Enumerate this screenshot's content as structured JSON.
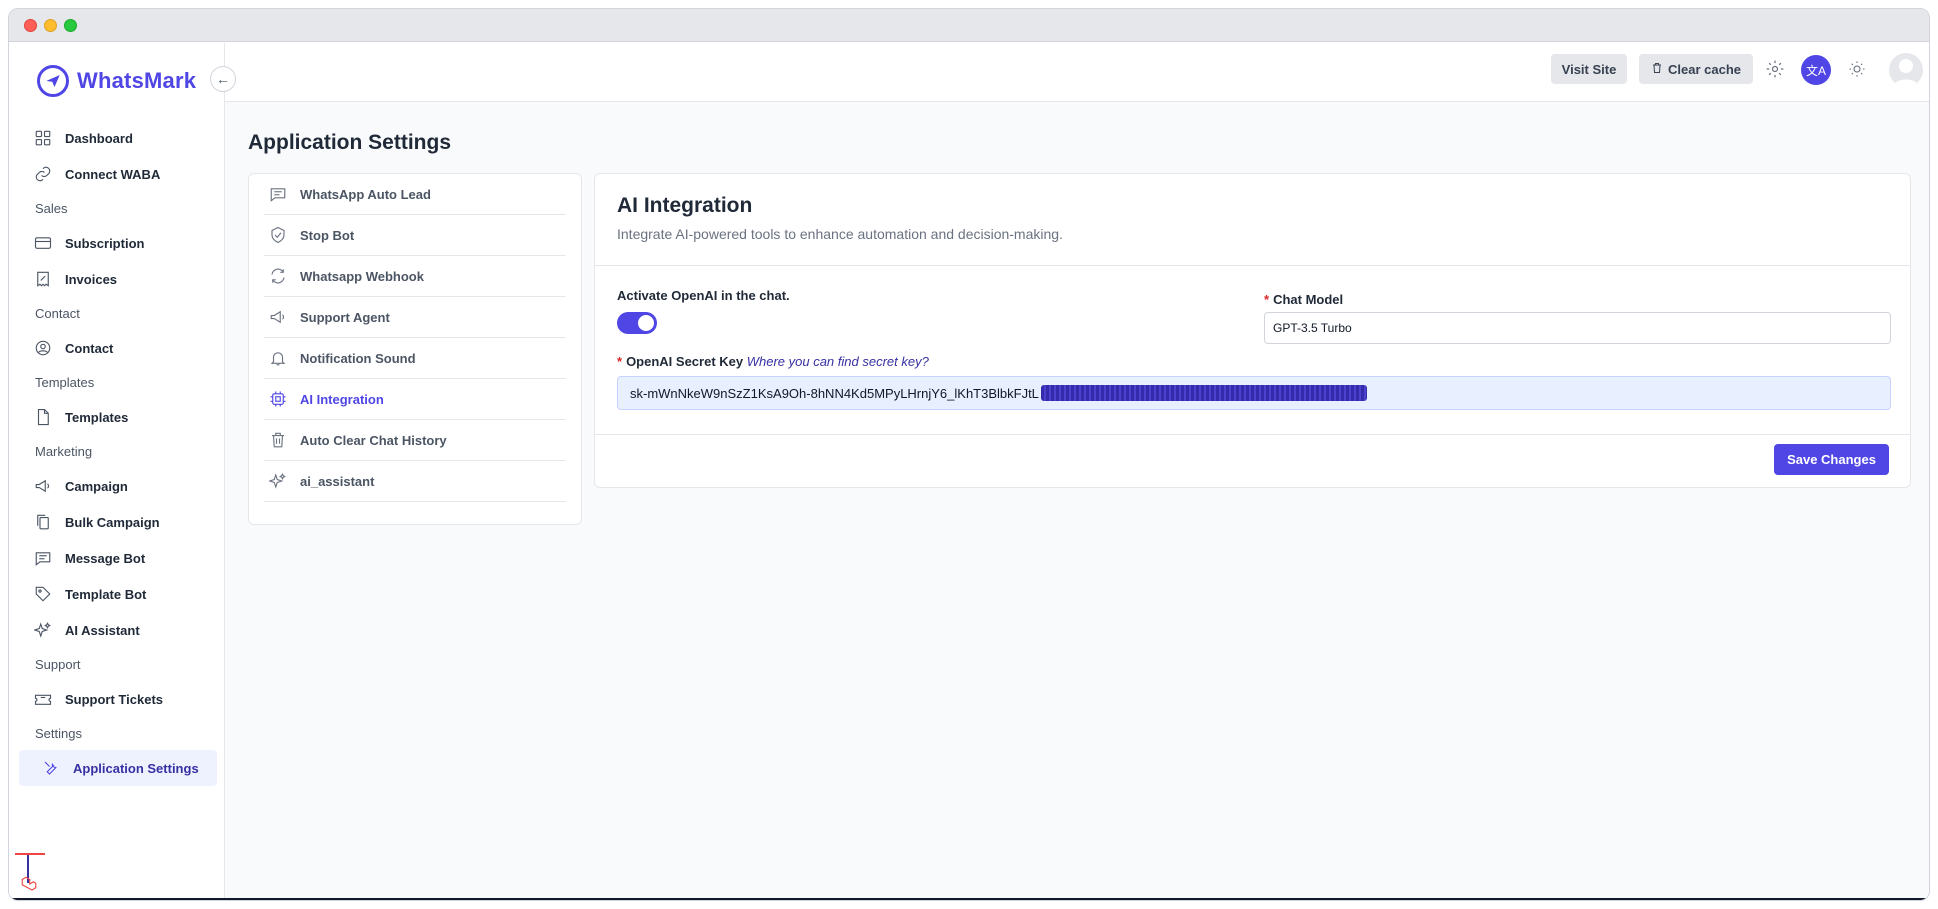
{
  "brand": {
    "name": "WhatsMark",
    "accent": "#4f46e5"
  },
  "sidebar": {
    "items": [
      {
        "type": "item",
        "label": "Dashboard",
        "icon": "grid-icon"
      },
      {
        "type": "item",
        "label": "Connect WABA",
        "icon": "link-icon"
      },
      {
        "type": "section",
        "label": "Sales"
      },
      {
        "type": "item",
        "label": "Subscription",
        "icon": "card-icon"
      },
      {
        "type": "item",
        "label": "Invoices",
        "icon": "invoice-icon"
      },
      {
        "type": "section",
        "label": "Contact"
      },
      {
        "type": "item",
        "label": "Contact",
        "icon": "user-circle-icon"
      },
      {
        "type": "section",
        "label": "Templates"
      },
      {
        "type": "item",
        "label": "Templates",
        "icon": "file-icon"
      },
      {
        "type": "section",
        "label": "Marketing"
      },
      {
        "type": "item",
        "label": "Campaign",
        "icon": "megaphone-icon"
      },
      {
        "type": "item",
        "label": "Bulk Campaign",
        "icon": "copy-icon"
      },
      {
        "type": "item",
        "label": "Message Bot",
        "icon": "chat-icon"
      },
      {
        "type": "item",
        "label": "Template Bot",
        "icon": "tag-icon"
      },
      {
        "type": "item",
        "label": "AI Assistant",
        "icon": "sparkles-icon"
      },
      {
        "type": "section",
        "label": "Support"
      },
      {
        "type": "item",
        "label": "Support Tickets",
        "icon": "ticket-icon"
      },
      {
        "type": "section",
        "label": "Settings"
      },
      {
        "type": "item",
        "label": "Application Settings",
        "icon": "wrench-icon",
        "active": true
      }
    ]
  },
  "topbar": {
    "visit_site": "Visit Site",
    "clear_cache": "Clear cache",
    "lang": "文A"
  },
  "page": {
    "title": "Application Settings"
  },
  "settings_menu": [
    {
      "label": "WhatsApp Auto Lead",
      "icon": "chat-icon"
    },
    {
      "label": "Stop Bot",
      "icon": "shield-check-icon"
    },
    {
      "label": "Whatsapp Webhook",
      "icon": "refresh-icon"
    },
    {
      "label": "Support Agent",
      "icon": "megaphone-icon"
    },
    {
      "label": "Notification Sound",
      "icon": "bell-icon"
    },
    {
      "label": "AI Integration",
      "icon": "cpu-icon",
      "active": true
    },
    {
      "label": "Auto Clear Chat History",
      "icon": "trash-icon"
    },
    {
      "label": "ai_assistant",
      "icon": "sparkles-icon"
    }
  ],
  "panel": {
    "title": "AI Integration",
    "subtitle": "Integrate AI-powered tools to enhance automation and decision-making.",
    "activate_label": "Activate OpenAI in the chat.",
    "activate_on": true,
    "required_mark": "*",
    "chat_model_label": "Chat Model",
    "chat_model_value": "GPT-3.5 Turbo",
    "secret_key_label": "OpenAI Secret Key",
    "secret_key_link": "Where you can find secret key?",
    "secret_key_value": "sk-mWnNkeW9nSzZ1KsA9Oh-8hNN4Kd5MPyLHrnjY6_lKhT3BlbkFJtL",
    "save_label": "Save Changes"
  }
}
